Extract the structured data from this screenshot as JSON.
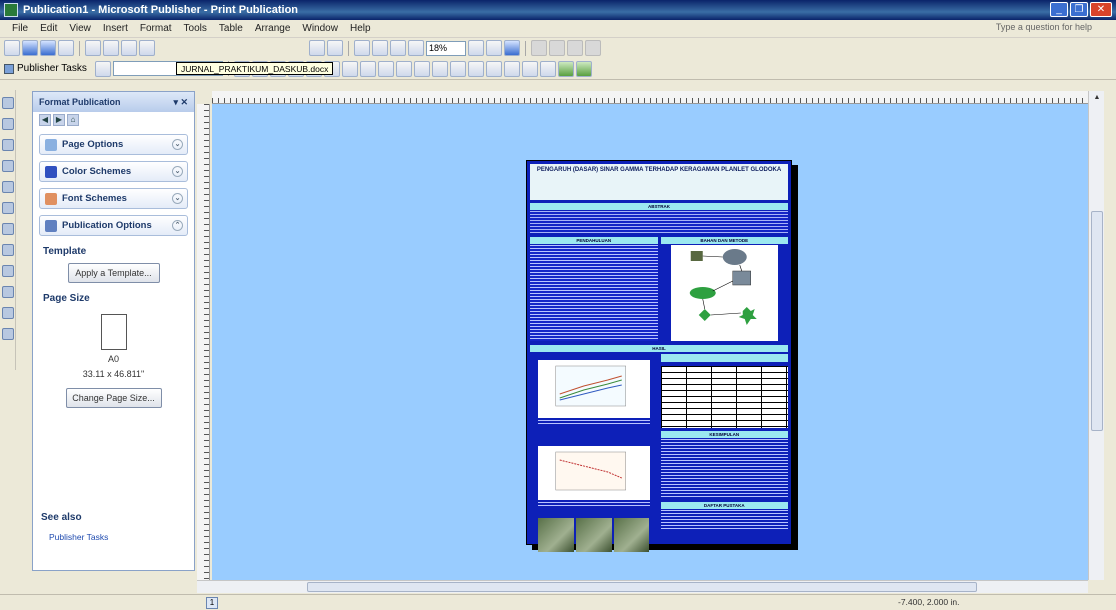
{
  "window": {
    "title": "Publication1 - Microsoft Publisher - Print Publication",
    "help_placeholder": "Type a question for help"
  },
  "menu": [
    "File",
    "Edit",
    "View",
    "Insert",
    "Format",
    "Tools",
    "Table",
    "Arrange",
    "Window",
    "Help"
  ],
  "toolbar": {
    "zoom": "18%",
    "tooltip": "JURNAL_PRAKTIKUM_DASKUB.docx",
    "publisher_tasks": "Publisher Tasks"
  },
  "taskpane": {
    "title": "Format Publication",
    "items": [
      "Page Options",
      "Color Schemes",
      "Font Schemes",
      "Publication Options"
    ],
    "template_heading": "Template",
    "apply_template": "Apply a Template...",
    "page_size_heading": "Page Size",
    "page_size_name": "A0",
    "page_size_dims": "33.11 x 46.811\"",
    "change_page_size": "Change Page Size...",
    "see_also": "See also",
    "see_also_link": "Publisher Tasks"
  },
  "poster": {
    "title": "PENGARUH (DASAR) SINAR GAMMA TERHADAP KERAGAMAN PLANLET GLODOKA",
    "abstract_label": "ABSTRAK",
    "intro_label": "PENDAHULUAN",
    "method_label": "BAHAN DAN METODE",
    "results_label": "HASIL",
    "conclusion_label": "KESIMPULAN",
    "references_label": "DAFTAR PUSTAKA"
  },
  "status": {
    "page": "1",
    "coords": "-7.400, 2.000 in."
  },
  "colors": {
    "workspace": "#99ccff",
    "poster_bg": "#0d20b8",
    "section_bar": "#9be8f0"
  }
}
